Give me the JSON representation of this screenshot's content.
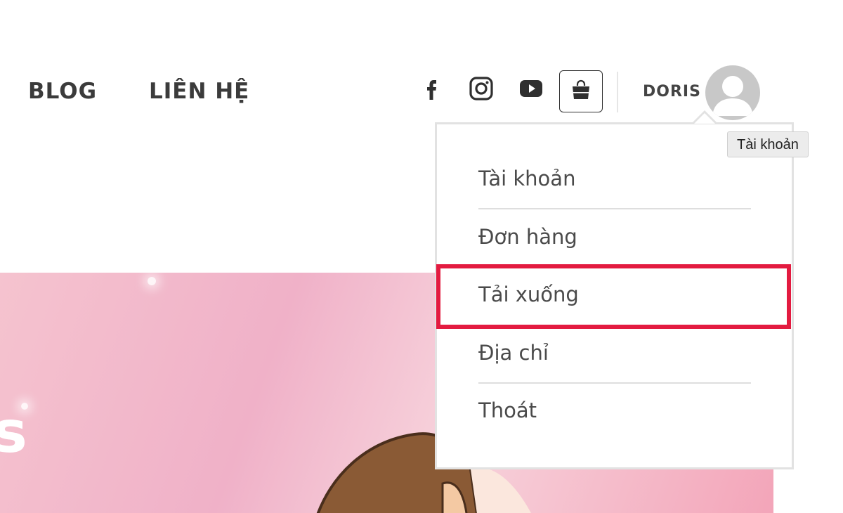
{
  "nav": {
    "links": [
      {
        "label": "BLOG"
      },
      {
        "label": "LIÊN HỆ"
      }
    ]
  },
  "social": [
    {
      "icon": "facebook-icon"
    },
    {
      "icon": "instagram-icon"
    },
    {
      "icon": "youtube-icon"
    }
  ],
  "cart": {
    "icon": "shopping-bag-icon"
  },
  "user": {
    "name": "DORIS",
    "avatar_icon": "default-avatar-icon",
    "tooltip": "Tài khoản"
  },
  "account_menu": {
    "items": [
      {
        "label": "Tài khoản"
      },
      {
        "label": "Đơn hàng"
      },
      {
        "label": "Tải xuống",
        "highlighted": true
      },
      {
        "label": "Địa chỉ"
      },
      {
        "label": "Thoát"
      }
    ]
  },
  "hero": {
    "visible_letter": "s"
  },
  "colors": {
    "highlight": "#e31b40",
    "text": "#3b3b3b",
    "hero_pink": "#f0b1c8"
  }
}
